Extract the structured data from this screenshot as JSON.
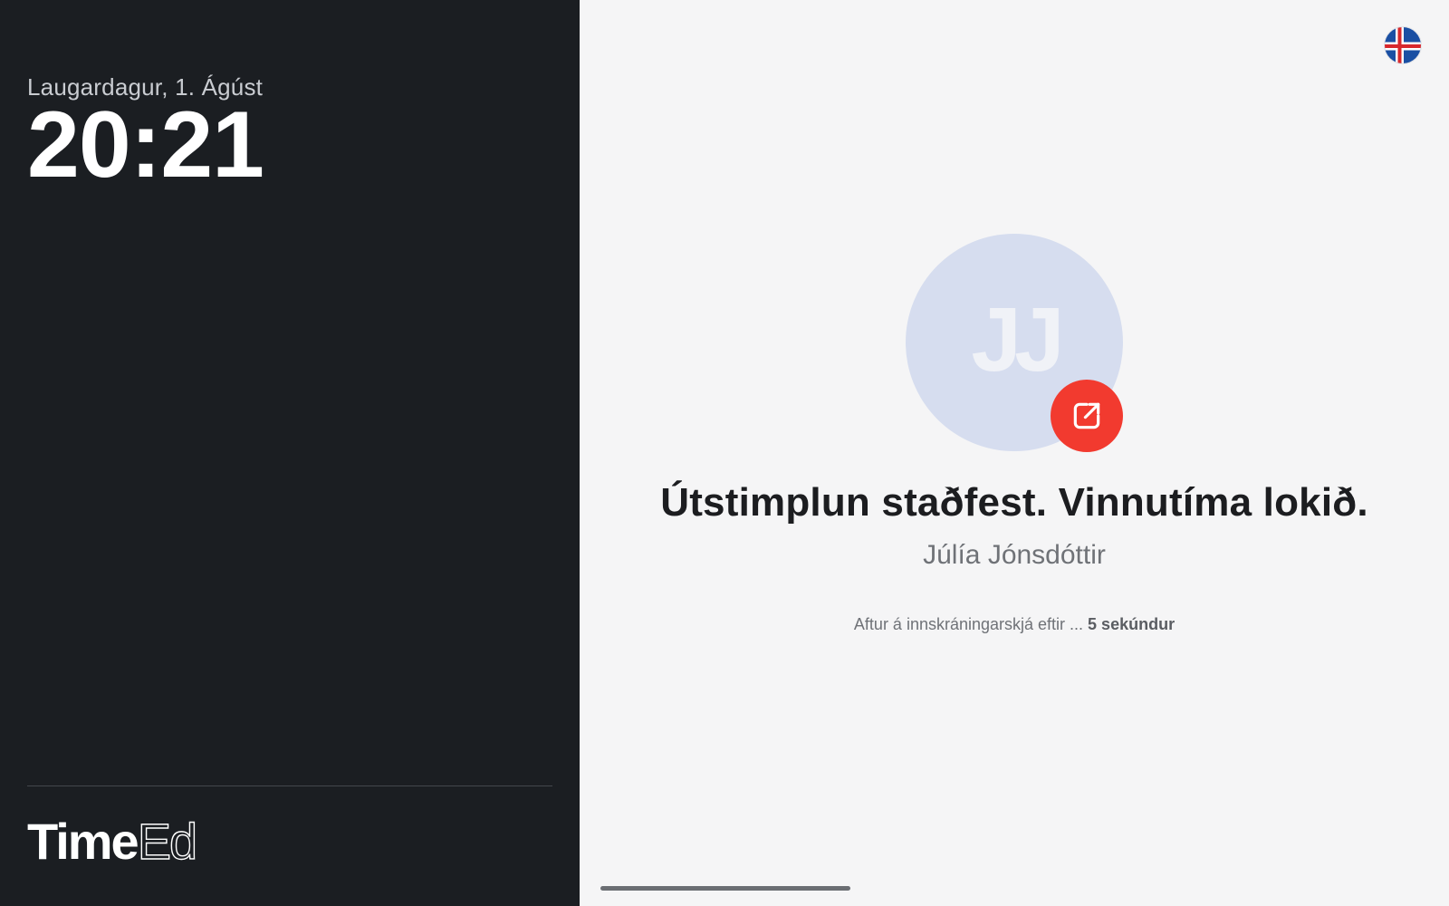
{
  "left_panel": {
    "date": "Laugardagur, 1. Ágúst",
    "time": "20:21",
    "brand": {
      "bold": "Time",
      "thin": "Ed"
    }
  },
  "right_panel": {
    "language_flag_icon": "iceland-flag-icon",
    "avatar": {
      "initials": "JJ",
      "background_color": "#d6ddef"
    },
    "clockout_badge": {
      "icon": "external-link-icon",
      "color": "#f23a2f"
    },
    "status_title": "Útstimplun staðfest. Vinnutíma lokið.",
    "employee_name": "Júlía Jónsdóttir",
    "redirect": {
      "prefix": "Aftur á innskráningarskjá eftir ...",
      "countdown": "5 sekúndur"
    }
  },
  "colors": {
    "left_background": "#1b1e22",
    "right_background": "#f5f5f6",
    "accent_red": "#f23a2f"
  }
}
